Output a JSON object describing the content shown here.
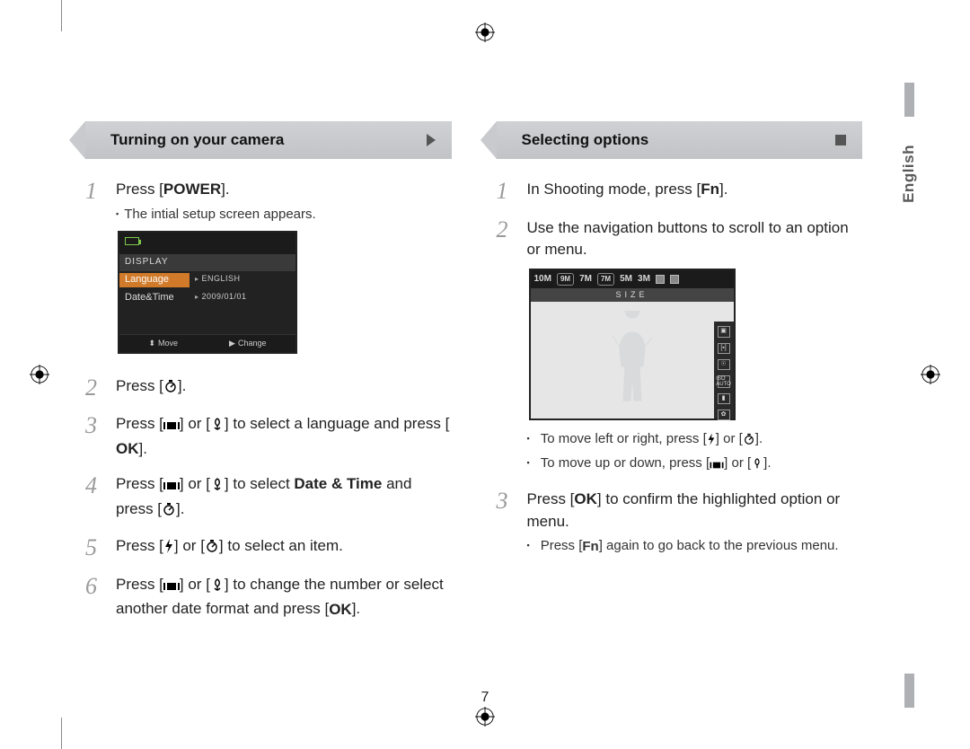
{
  "page_number": "7",
  "language_tab": "English",
  "left": {
    "heading": "Turning on your camera",
    "step1_a": "Press [",
    "step1_b": "POWER",
    "step1_c": "].",
    "step1_sub": "The intial setup screen appears.",
    "lcd": {
      "display_label": "DISPLAY",
      "lang_label": "Language",
      "lang_value": "ENGLISH",
      "dt_label": "Date&Time",
      "dt_value": "2009/01/01",
      "move": "Move",
      "change": "Change"
    },
    "step2_a": "Press [",
    "step2_b": "].",
    "step3_a": "Press [",
    "step3_b": "] or [",
    "step3_c": "] to select a language and press [",
    "step3_d": "].",
    "step4_a": "Press [",
    "step4_b": "] or [",
    "step4_c": "] to select ",
    "step4_d": "Date & Time",
    "step4_e": " and press [",
    "step4_f": "].",
    "step5_a": "Press [",
    "step5_b": "] or [",
    "step5_c": "] to select an item.",
    "step6_a": "Press [",
    "step6_b": "] or [",
    "step6_c": "] to change the number or select another date format and press [",
    "step6_d": "]."
  },
  "right": {
    "heading": "Selecting options",
    "step1_a": "In Shooting mode, press [",
    "step1_b": "].",
    "step2": "Use the navigation buttons to scroll to an option or menu.",
    "lcd2": {
      "top_items": [
        "10M",
        "9M",
        "7M",
        "7M",
        "5M",
        "3M",
        "1M",
        "1M"
      ],
      "size_label": "SIZE"
    },
    "sub_a_1": "To move left or right, press [",
    "sub_a_2": "] or [",
    "sub_a_3": "].",
    "sub_b_1": "To move up or down, press [",
    "sub_b_2": "] or [",
    "sub_b_3": "].",
    "step3_a": "Press [",
    "step3_b": "] to confirm the highlighted option or menu.",
    "step3_sub_a": "Press [",
    "step3_sub_b": "] again to go back to the previous menu."
  },
  "icons": {
    "ok": "OK",
    "fn": "Fn",
    "timer": "timer-icon",
    "disp": "display-icon",
    "macro": "macro-icon",
    "flash": "flash-icon"
  }
}
